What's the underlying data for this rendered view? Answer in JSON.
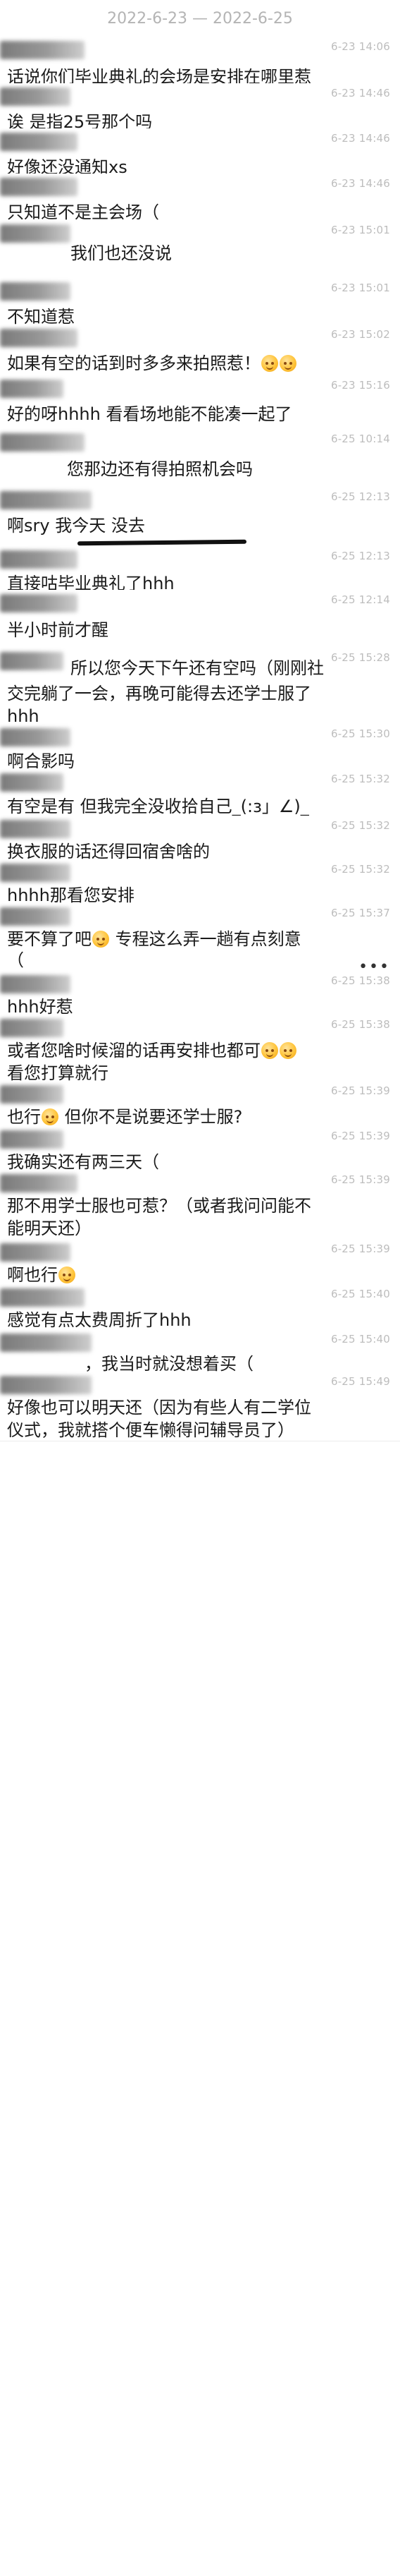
{
  "header": {
    "date_range": "2022-6-23 — 2022-6-25"
  },
  "messages": [
    {
      "time": "6-23 14:06",
      "lines": [
        "话说你们毕业典礼的会场是安排在哪里惹"
      ]
    },
    {
      "time": "6-23 14:46",
      "lines": [
        "诶 是指25号那个吗"
      ]
    },
    {
      "time": "6-23 14:46",
      "lines": [
        "好像还没通知xs"
      ]
    },
    {
      "time": "6-23 14:46",
      "lines": [
        "只知道不是主会场（"
      ]
    },
    {
      "time": "6-23 15:01",
      "lines": [
        "我们也还没说"
      ]
    },
    {
      "time": "6-23 15:01",
      "lines": [
        "不知道惹"
      ]
    },
    {
      "time": "6-23 15:02",
      "lines": [
        "如果有空的话到时多多来拍照惹！"
      ]
    },
    {
      "time": "6-23 15:16",
      "lines": [
        "好的呀hhhh 看看场地能不能凑一起了"
      ]
    },
    {
      "time": "6-25 10:14",
      "lines": [
        "您那边还有得拍照机会吗"
      ]
    },
    {
      "time": "6-25 12:13",
      "lines": [
        "啊sry 我今天 没去"
      ]
    },
    {
      "time": "6-25 12:13",
      "lines": [
        "直接咕毕业典礼了hhh"
      ]
    },
    {
      "time": "6-25 12:14",
      "lines": [
        "半小时前才醒"
      ]
    },
    {
      "time": "6-25 15:28",
      "lines": [
        "所以您今天下午还有空吗（刚刚社",
        "交完躺了一会，再晚可能得去还学士服了",
        "hhh"
      ]
    },
    {
      "time": "6-25 15:30",
      "lines": [
        "啊合影吗"
      ]
    },
    {
      "time": "6-25 15:32",
      "lines": [
        "有空是有 但我完全没收拾自己_(:з」∠)_"
      ]
    },
    {
      "time": "6-25 15:32",
      "lines": [
        "换衣服的话还得回宿舍啥的"
      ]
    },
    {
      "time": "6-25 15:32",
      "lines": [
        "hhhh那看您安排"
      ]
    },
    {
      "time": "6-25 15:37",
      "lines": [
        "要不算了吧 专程这么弄一趟有点刻意",
        "（"
      ]
    },
    {
      "time": "6-25 15:38",
      "lines": [
        "hhh好惹"
      ]
    },
    {
      "time": "6-25 15:38",
      "lines": [
        "或者您啥时候溜的话再安排也都可",
        "看您打算就行"
      ]
    },
    {
      "time": "6-25 15:39",
      "lines": [
        "也行 但你不是说要还学士服?"
      ]
    },
    {
      "time": "6-25 15:39",
      "lines": [
        "我确实还有两三天（"
      ]
    },
    {
      "time": "6-25 15:39",
      "lines": [
        "那不用学士服也可惹？（或者我问问能不",
        "能明天还）"
      ]
    },
    {
      "time": "6-25 15:39",
      "lines": [
        "啊也行"
      ]
    },
    {
      "time": "6-25 15:40",
      "lines": [
        "感觉有点太费周折了hhh"
      ]
    },
    {
      "time": "6-25 15:40",
      "lines": [
        "，我当时就没想着买（"
      ]
    },
    {
      "time": "6-25 15:49",
      "lines": [
        "好像也可以明天还（因为有些人有二学位",
        "仪式，我就搭个便车懒得问辅导员了）"
      ]
    }
  ],
  "menu": {
    "more_label": "•••"
  }
}
